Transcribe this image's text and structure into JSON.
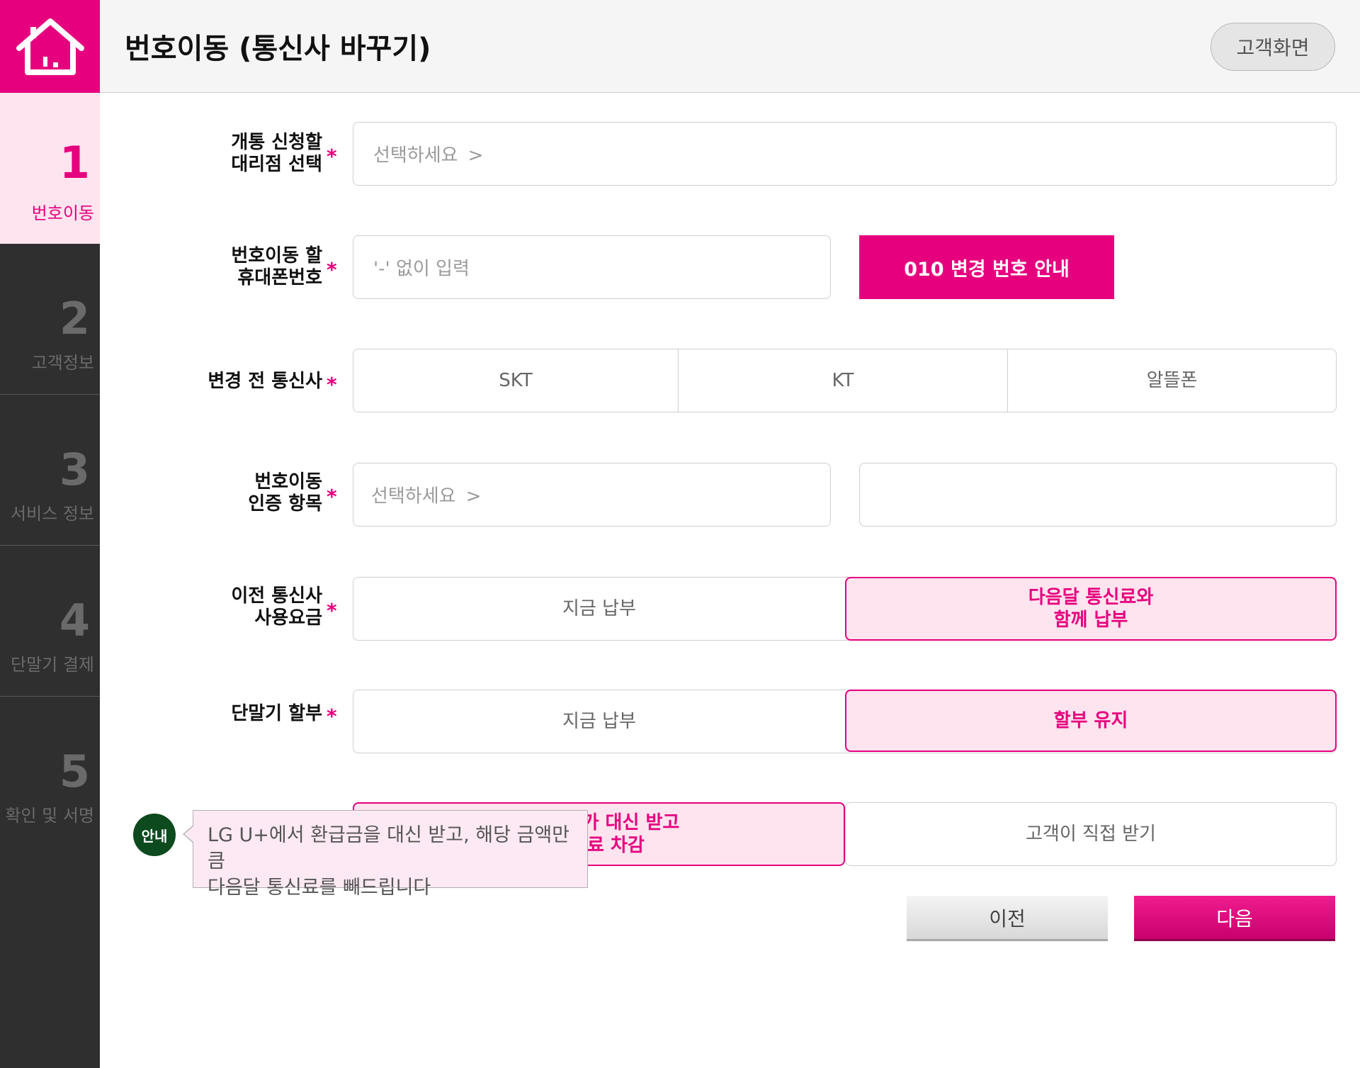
{
  "header": {
    "title": "번호이동 (통신사 바꾸기)",
    "customer_screen_label": "고객화면"
  },
  "sidebar": {
    "home_icon": "house-icon",
    "steps": [
      {
        "num": "1",
        "label": "번호이동"
      },
      {
        "num": "2",
        "label": "고객정보"
      },
      {
        "num": "3",
        "label": "서비스 정보"
      },
      {
        "num": "4",
        "label": "단말기 결제"
      },
      {
        "num": "5",
        "label": "확인 및 서명"
      }
    ]
  },
  "form": {
    "dealer": {
      "label_line1": "개통 신청할",
      "label_line2": "대리점 선택",
      "placeholder": "선택하세요"
    },
    "phone": {
      "label_line1": "번호이동 할",
      "label_line2": "휴대폰번호",
      "placeholder": "'-' 없이 입력",
      "guide_button": "010 변경 번호 안내"
    },
    "carrier": {
      "label": "변경 전 통신사",
      "options": [
        "SKT",
        "KT",
        "알뜰폰"
      ]
    },
    "auth": {
      "label_line1": "번호이동",
      "label_line2": "인증 항목",
      "placeholder": "선택하세요",
      "value": ""
    },
    "prev_fee": {
      "label_line1": "이전 통신사",
      "label_line2": "사용요금",
      "option_now": "지금 납부",
      "option_next_line1": "다음달 통신료와",
      "option_next_line2": "함께 납부"
    },
    "installment": {
      "label": "단말기 할부",
      "option_now": "지금 납부",
      "option_keep": "할부 유지"
    },
    "refund": {
      "option_lgu_line1": "LG U+가 대신 받고",
      "option_lgu_line2": "통신료 차감",
      "option_self": "고객이 직접 받기"
    },
    "required_mark": "*"
  },
  "tooltip": {
    "badge": "안내",
    "line1": "LG U+에서 환급금을 대신 받고, 해당 금액만큼",
    "line2": "다음달 통신료를 빼드립니다"
  },
  "nav": {
    "prev": "이전",
    "next": "다음"
  },
  "colors": {
    "accent": "#e6007e",
    "sidebar_bg": "#2f2f2f",
    "selected_bg": "#fde4ee",
    "badge_green": "#0d4a1e"
  }
}
